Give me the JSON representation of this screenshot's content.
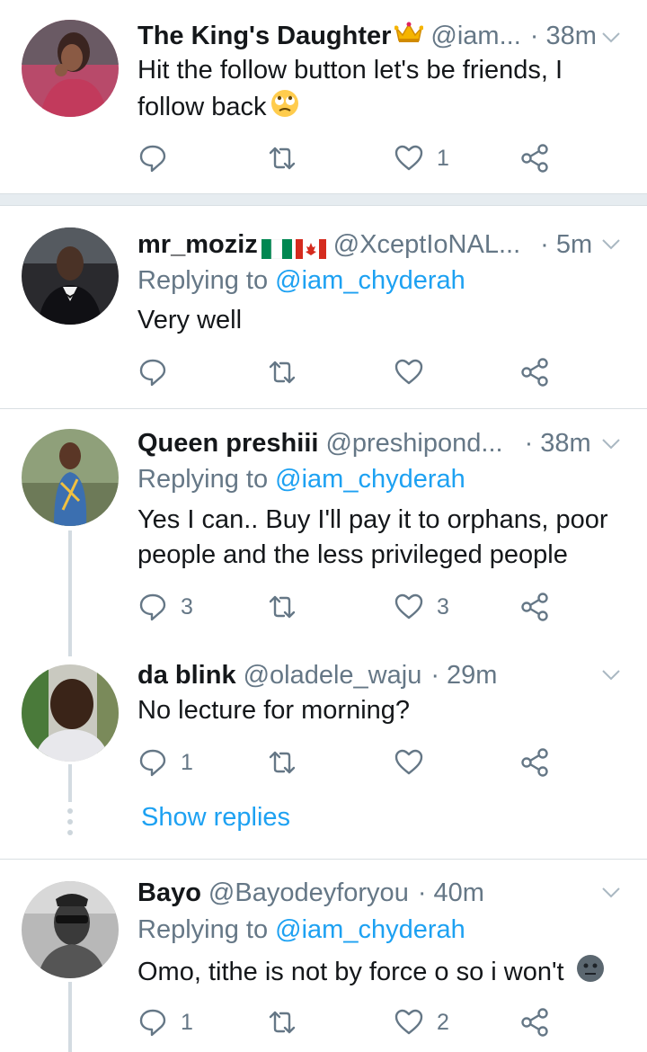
{
  "tweets": [
    {
      "name": "The King's Daughter",
      "name_emoji": "crown",
      "handle": "@iam...",
      "time": "· 38m",
      "text": "Hit the follow button let's be friends, I follow back",
      "text_emoji": "rolling-eyes-face",
      "reply_count": "",
      "retweet_count": "",
      "like_count": "1"
    },
    {
      "name": "mr_moziz",
      "name_flags": [
        "nigeria-flag",
        "canada-flag"
      ],
      "handle": "@XceptIoNAL...",
      "time": "· 5m",
      "replying_label": "Replying to",
      "replying_to": "@iam_chyderah",
      "text": "Very well",
      "reply_count": "",
      "retweet_count": "",
      "like_count": ""
    },
    {
      "name": "Queen preshiii",
      "handle": "@preshipond...",
      "time": "· 38m",
      "replying_label": "Replying to",
      "replying_to": "@iam_chyderah",
      "text": "Yes I can.. Buy I'll pay it to orphans, poor people and the less privileged people",
      "reply_count": "3",
      "retweet_count": "",
      "like_count": "3"
    },
    {
      "name": "da blink",
      "handle": "@oladele_waju",
      "time": "· 29m",
      "text": "No lecture for morning?",
      "reply_count": "1",
      "retweet_count": "",
      "like_count": "",
      "show_replies": "Show replies"
    },
    {
      "name": "Bayo",
      "handle": "@Bayodeyforyou",
      "time": "· 40m",
      "replying_label": "Replying to",
      "replying_to": "@iam_chyderah",
      "text": "Omo, tithe is not by force o so i won't",
      "text_emoji": "neutral-face",
      "reply_count": "1",
      "retweet_count": "",
      "like_count": "2"
    }
  ],
  "colors": {
    "link": "#1da1f2",
    "muted": "#657786",
    "text": "#14171a",
    "divider": "#e6ecf0"
  }
}
